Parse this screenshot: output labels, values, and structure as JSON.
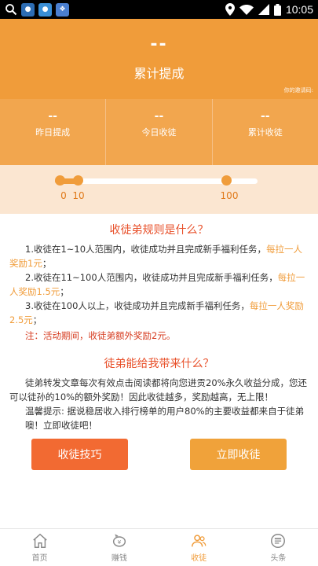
{
  "statusbar": {
    "time": "10:05",
    "icons": [
      "search-icon",
      "app-icon",
      "app-icon",
      "paw-icon",
      "location-icon",
      "wifi-icon",
      "signal-icon",
      "battery-icon"
    ]
  },
  "header": {
    "total_value": "--",
    "total_label": "累计提成",
    "invite_label": "你的邀请码:"
  },
  "stats": [
    {
      "value": "--",
      "label": "昨日提成"
    },
    {
      "value": "--",
      "label": "今日收徒"
    },
    {
      "value": "--",
      "label": "累计收徒"
    }
  ],
  "progress": {
    "fill_fraction": 0.13,
    "milestones": [
      "0",
      "10",
      "100"
    ]
  },
  "rules": {
    "title": "收徒弟规则是什么？",
    "items": [
      {
        "text": "1.收徒在1~10人范围内，收徒成功并且完成新手福利任务，",
        "highlight": "每拉一人奖励1元",
        "end": "；"
      },
      {
        "text": "2.收徒在11~100人范围内，收徒成功并且完成新手福利任务，",
        "highlight": "每拉一人奖励1.5元",
        "end": "；"
      },
      {
        "text": "3.收徒在100人以上，收徒成功并且完成新手福利任务，",
        "highlight": "每拉一人奖励2.5元",
        "end": "；"
      }
    ],
    "note": "注：活动期间，收徒弟额外奖励2元。"
  },
  "benefits": {
    "title": "徒弟能给我带来什么？",
    "paragraph1": "徒弟转发文章每次有效点击阅读都将向您进贡20%永久收益分成，您还可以徒孙的10%的额外奖励！因此收徒越多，奖励越高，无上限！",
    "paragraph2": "温馨提示: 据说稳居收入排行榜单的用户80%的主要收益都来自于徒弟噢！立即收徒吧！"
  },
  "buttons": {
    "tips": "收徒技巧",
    "recruit": "立即收徒"
  },
  "nav": [
    {
      "label": "首页",
      "icon": "home-icon",
      "active": false
    },
    {
      "label": "赚钱",
      "icon": "piggy-bank-icon",
      "active": false
    },
    {
      "label": "收徒",
      "icon": "users-icon",
      "active": true
    },
    {
      "label": "头条",
      "icon": "news-icon",
      "active": false
    }
  ],
  "colors": {
    "header_bg": "#f09c3a",
    "accent": "#f09c3a",
    "title_red": "#e8502a",
    "tips_button": "#f26a32"
  }
}
